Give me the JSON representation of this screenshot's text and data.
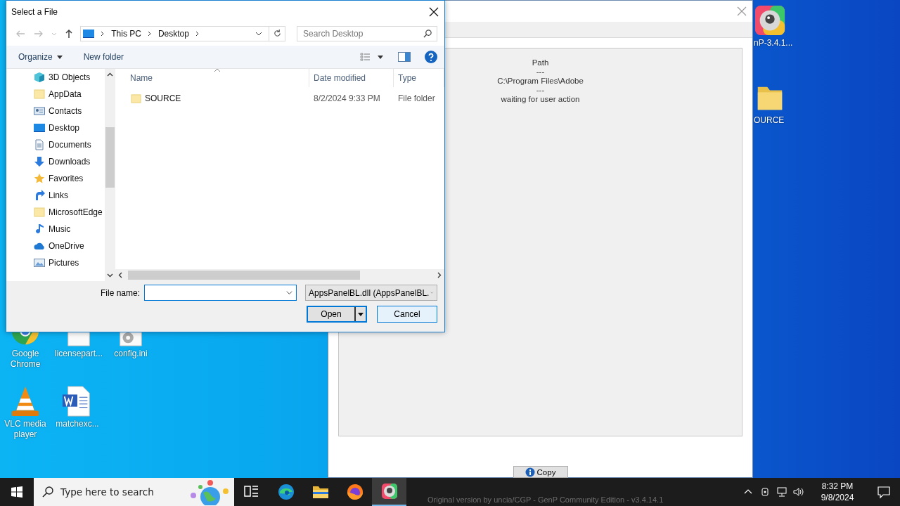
{
  "desktop_icons": [
    {
      "label": "nP-3.4.1...",
      "kind": "genp"
    },
    {
      "label": "OURCE",
      "kind": "folder"
    },
    {
      "label": "Google Chrome",
      "kind": "chrome"
    },
    {
      "label": "licensepart...",
      "kind": "file"
    },
    {
      "label": "config.ini",
      "kind": "config"
    },
    {
      "label": "VLC media player",
      "kind": "vlc"
    },
    {
      "label": "matchexc...",
      "kind": "word"
    }
  ],
  "background_window": {
    "panel_lines": [
      "Path",
      "---",
      "C:\\Program Files\\Adobe",
      "---",
      "waiting for user action"
    ],
    "copy_button": "Copy",
    "footer": "Original version by uncia/CGP - GenP Community Edition - v3.4.14.1"
  },
  "dialog": {
    "title": "Select a File",
    "breadcrumb": [
      "This PC",
      "Desktop"
    ],
    "search_placeholder": "Search Desktop",
    "organize": "Organize",
    "new_folder": "New folder",
    "nav_items": [
      {
        "label": "3D Objects",
        "kind": "cube"
      },
      {
        "label": "AppData",
        "kind": "folder"
      },
      {
        "label": "Contacts",
        "kind": "contacts"
      },
      {
        "label": "Desktop",
        "kind": "desktop"
      },
      {
        "label": "Documents",
        "kind": "documents"
      },
      {
        "label": "Downloads",
        "kind": "downloads"
      },
      {
        "label": "Favorites",
        "kind": "star"
      },
      {
        "label": "Links",
        "kind": "links"
      },
      {
        "label": "MicrosoftEdge",
        "kind": "folder"
      },
      {
        "label": "Music",
        "kind": "music"
      },
      {
        "label": "OneDrive",
        "kind": "cloud"
      },
      {
        "label": "Pictures",
        "kind": "pictures"
      }
    ],
    "columns": [
      "Name",
      "Date modified",
      "Type"
    ],
    "files": [
      {
        "name": "SOURCE",
        "date": "8/2/2024 9:33 PM",
        "type": "File folder"
      }
    ],
    "file_name_label": "File name:",
    "file_type": "AppsPanelBL.dll (AppsPanelBL.",
    "open_button": "Open",
    "cancel_button": "Cancel"
  },
  "taskbar": {
    "search_placeholder": "Type here to search",
    "apps": [
      {
        "kind": "taskview",
        "selected": false
      },
      {
        "kind": "edge",
        "selected": false
      },
      {
        "kind": "explorer",
        "selected": false
      },
      {
        "kind": "firefox",
        "selected": false
      },
      {
        "kind": "genp",
        "selected": true
      }
    ],
    "time": "8:32 PM",
    "date": "9/8/2024"
  }
}
